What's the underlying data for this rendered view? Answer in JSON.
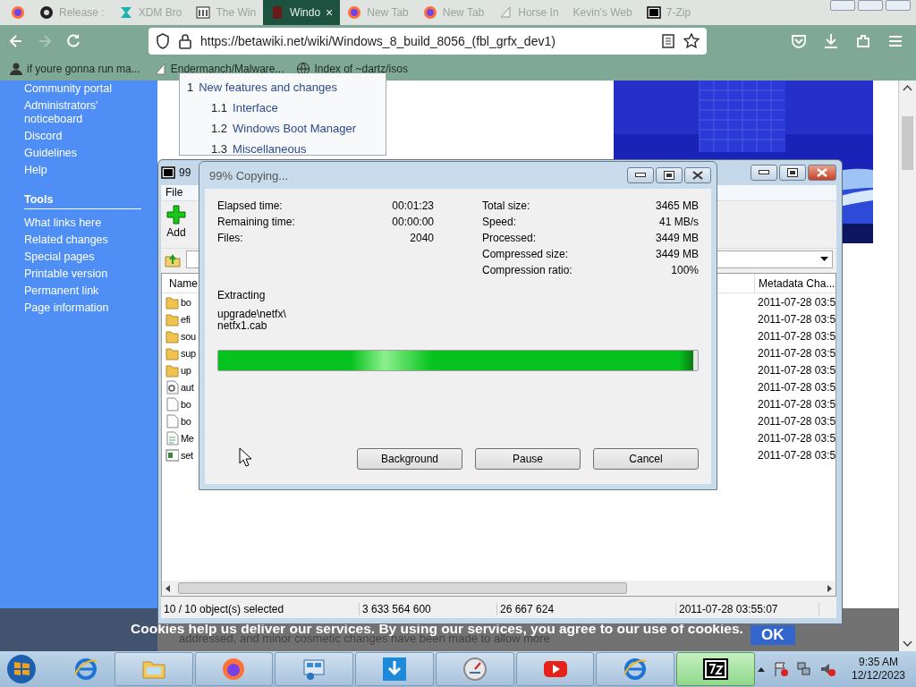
{
  "browser": {
    "tabs": [
      {
        "kind": "firefox",
        "selected": false
      },
      {
        "kind": "github",
        "label": "Release :",
        "selected": false
      },
      {
        "kind": "xdm",
        "label": "XDM Bro",
        "selected": false
      },
      {
        "kind": "wiki",
        "label": "The Win",
        "selected": false
      },
      {
        "kind": "beta",
        "label": "Windo",
        "selected": true,
        "close": "×"
      },
      {
        "kind": "firefox",
        "label": "New Tab",
        "selected": false
      },
      {
        "kind": "firefox",
        "label": "New Tab",
        "selected": false
      },
      {
        "kind": "horse",
        "label": "Horse In",
        "selected": false
      },
      {
        "kind": "none",
        "label": "Kevin's Web",
        "selected": false
      },
      {
        "kind": "sevenzip",
        "label": "7-Zip",
        "selected": false
      }
    ],
    "url": "https://betawiki.net/wiki/Windows_8_build_8056_(fbl_grfx_dev1)",
    "bookmarks": [
      {
        "kind": "user",
        "label": "if youre gonna run ma..."
      },
      {
        "kind": "page",
        "label": "Endermanch/Malware..."
      },
      {
        "kind": "globe",
        "label": "Index of ~dartz/isos"
      }
    ]
  },
  "wiki": {
    "sidebar": [
      {
        "kind": "link",
        "label": "Community portal"
      },
      {
        "kind": "link",
        "label": "Administrators' noticeboard"
      },
      {
        "kind": "link",
        "label": "Discord"
      },
      {
        "kind": "link",
        "label": "Guidelines"
      },
      {
        "kind": "link",
        "label": "Help"
      },
      {
        "kind": "heading",
        "label": "Tools"
      },
      {
        "kind": "link",
        "label": "What links here"
      },
      {
        "kind": "link",
        "label": "Related changes"
      },
      {
        "kind": "link",
        "label": "Special pages"
      },
      {
        "kind": "link",
        "label": "Printable version"
      },
      {
        "kind": "link",
        "label": "Permanent link"
      },
      {
        "kind": "link",
        "label": "Page information"
      }
    ],
    "toc": [
      {
        "number": "1",
        "label": "New features and changes",
        "children": [
          {
            "number": "1.1",
            "label": "Interface"
          },
          {
            "number": "1.2",
            "label": "Windows Boot Manager"
          },
          {
            "number": "1.3",
            "label": "Miscellaneous"
          }
        ]
      }
    ],
    "body_text": "addressed, and minor cosmetic changes have been made to allow more",
    "cookie_notice": {
      "text": "Cookies help us deliver our services. By using our services, you agree to our use of cookies.",
      "button": "OK"
    }
  },
  "file_manager": {
    "title": "99",
    "menu": [
      "File"
    ],
    "toolbar": [
      "Add"
    ],
    "columns": [
      "Name",
      "Metadata Cha..."
    ],
    "rows": [
      {
        "kind": "folder",
        "name": "bo",
        "date": "2011-07-28 03:5"
      },
      {
        "kind": "folder",
        "name": "efi",
        "date": "2011-07-28 03:5"
      },
      {
        "kind": "folder",
        "name": "sou",
        "date": "2011-07-28 03:5"
      },
      {
        "kind": "folder",
        "name": "sup",
        "date": "2011-07-28 03:5"
      },
      {
        "kind": "folder",
        "name": "up",
        "date": "2011-07-28 03:5"
      },
      {
        "kind": "settings",
        "name": "aut",
        "date": "2011-07-28 03:5"
      },
      {
        "kind": "file",
        "name": "bo",
        "date": "2011-07-28 03:5"
      },
      {
        "kind": "file",
        "name": "bo",
        "date": "2011-07-28 03:5"
      },
      {
        "kind": "doc",
        "name": "Me",
        "date": "2011-07-28 03:5"
      },
      {
        "kind": "app",
        "name": "set",
        "date": "2011-07-28 03:5"
      }
    ],
    "status_bar": [
      "10 / 10 object(s) selected",
      "3 633 564 600",
      "26 667 624",
      "2011-07-28 03:55:07"
    ]
  },
  "progress_dialog": {
    "title": "99% Copying...",
    "left_stats": [
      {
        "label": "Elapsed time:",
        "value": "00:01:23"
      },
      {
        "label": "Remaining time:",
        "value": "00:00:00"
      },
      {
        "label": "Files:",
        "value": "2040"
      }
    ],
    "right_stats": [
      {
        "label": "Total size:",
        "value": "3465 MB"
      },
      {
        "label": "Speed:",
        "value": "41 MB/s"
      },
      {
        "label": "Processed:",
        "value": "3449 MB"
      },
      {
        "label": "Compressed size:",
        "value": "3449 MB"
      },
      {
        "label": "Compression ratio:",
        "value": "100%"
      }
    ],
    "operation": "Extracting",
    "path_lines": [
      "upgrade\\netfx\\",
      "netfx1.cab"
    ],
    "level": 0.99,
    "buttons": [
      "Background",
      "Pause",
      "Cancel"
    ]
  },
  "taskbar": {
    "apps": [
      {
        "kind": "ie",
        "selected": false
      },
      {
        "kind": "explorer",
        "selected": false
      },
      {
        "kind": "firefox",
        "selected": false
      },
      {
        "kind": "control",
        "selected": false
      },
      {
        "kind": "download",
        "selected": false
      },
      {
        "kind": "gauge",
        "selected": false
      },
      {
        "kind": "youtube",
        "selected": false
      },
      {
        "kind": "ie",
        "selected": false
      },
      {
        "kind": "sevenzip",
        "selected": true
      }
    ],
    "time": "9:35 AM",
    "date": "12/12/2023"
  }
}
